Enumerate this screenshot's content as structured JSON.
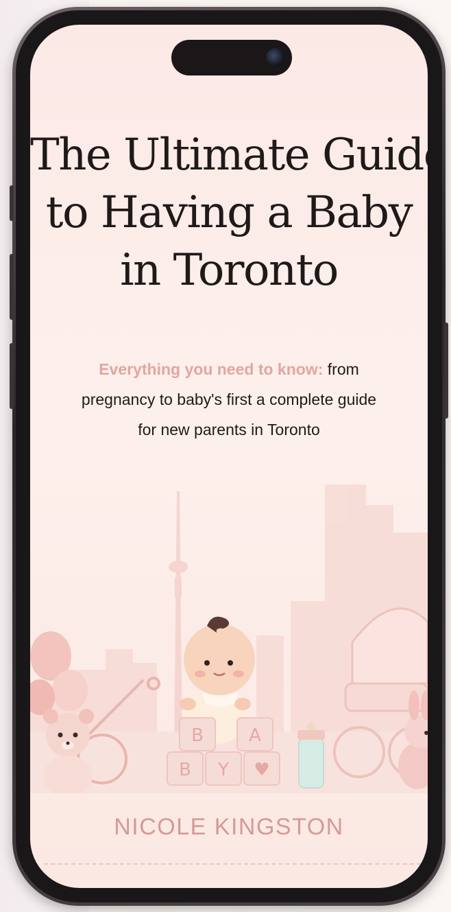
{
  "book": {
    "title_lines": [
      "The Ultimate Guide",
      "to Having a Baby",
      "in Toronto"
    ],
    "subtitle_highlight": "Everything you need to know:",
    "subtitle_rest_1": " from",
    "subtitle_line_2": "pregnancy to baby's first a complete guide",
    "subtitle_line_3": "for new parents in Toronto",
    "author": "NICOLE KINGSTON"
  },
  "illustration": {
    "blocks": [
      "B",
      "A",
      "B",
      "Y",
      "♥"
    ]
  },
  "colors": {
    "accent": "#e1a6a0",
    "author": "#d59a94",
    "background": "#fbe9e6"
  }
}
